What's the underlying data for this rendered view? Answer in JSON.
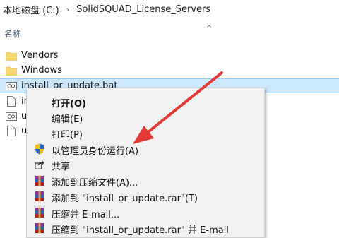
{
  "breadcrumb": {
    "items": [
      "本地磁盘 (C:)",
      "SolidSQUAD_License_Servers"
    ],
    "separator": "›"
  },
  "column_header": {
    "name_label": "名称",
    "sort_indicator": "^"
  },
  "files": [
    {
      "label": "Vendors",
      "type": "folder"
    },
    {
      "label": "Windows",
      "type": "folder"
    },
    {
      "label": "install_or_update.bat",
      "type": "bat",
      "selected": true
    },
    {
      "label": "in",
      "type": "file"
    },
    {
      "label": "ur",
      "type": "bat"
    },
    {
      "label": "ur",
      "type": "file"
    }
  ],
  "context_menu": {
    "items": [
      {
        "label": "打开(O)",
        "bold": true,
        "icon": ""
      },
      {
        "label": "编辑(E)",
        "icon": ""
      },
      {
        "label": "打印(P)",
        "icon": ""
      },
      {
        "label": "以管理员身份运行(A)",
        "icon": "uac-shield-icon"
      },
      {
        "label": "共享",
        "icon": "share-icon"
      },
      {
        "label": "添加到压缩文件(A)...",
        "icon": "winrar-icon"
      },
      {
        "label": "添加到 \"install_or_update.rar\"(T)",
        "icon": "winrar-icon"
      },
      {
        "label": "压缩并 E-mail...",
        "icon": "winrar-icon"
      },
      {
        "label": "压缩到 \"install_or_update.rar\" 并 E-mail",
        "icon": "winrar-icon"
      }
    ]
  },
  "colors": {
    "selection": "#cce8ff",
    "folder": "#f8d775",
    "arrow": "#e53935"
  }
}
